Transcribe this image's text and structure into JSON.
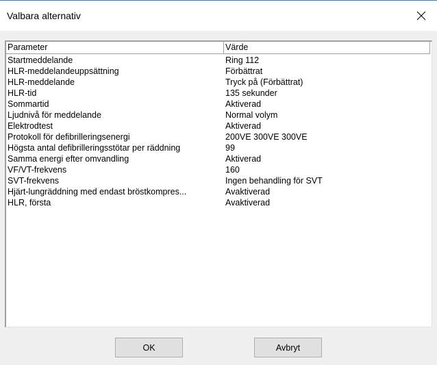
{
  "window": {
    "title": "Valbara alternativ"
  },
  "table": {
    "columns": [
      "Parameter",
      "Värde"
    ],
    "rows": [
      [
        "Startmeddelande",
        "Ring 112"
      ],
      [
        "HLR-meddelandeuppsättning",
        "Förbättrat"
      ],
      [
        "HLR-meddelande",
        "Tryck på (Förbättrat)"
      ],
      [
        "HLR-tid",
        "135 sekunder"
      ],
      [
        "Sommartid",
        "Aktiverad"
      ],
      [
        "Ljudnivå för meddelande",
        "Normal volym"
      ],
      [
        "Elektrodtest",
        "Aktiverad"
      ],
      [
        "Protokoll för defibrilleringsenergi",
        "200VE  300VE  300VE"
      ],
      [
        "Högsta antal defibrilleringsstötar per räddning",
        "99"
      ],
      [
        "Samma energi efter omvandling",
        "Aktiverad"
      ],
      [
        "VF/VT-frekvens",
        "160"
      ],
      [
        "SVT-frekvens",
        "Ingen behandling för SVT"
      ],
      [
        "Hjärt-lungräddning med endast bröstkompres...",
        "Avaktiverad"
      ],
      [
        "HLR, första",
        "Avaktiverad"
      ]
    ]
  },
  "buttons": {
    "ok_label": "OK",
    "cancel_label": "Avbryt"
  }
}
